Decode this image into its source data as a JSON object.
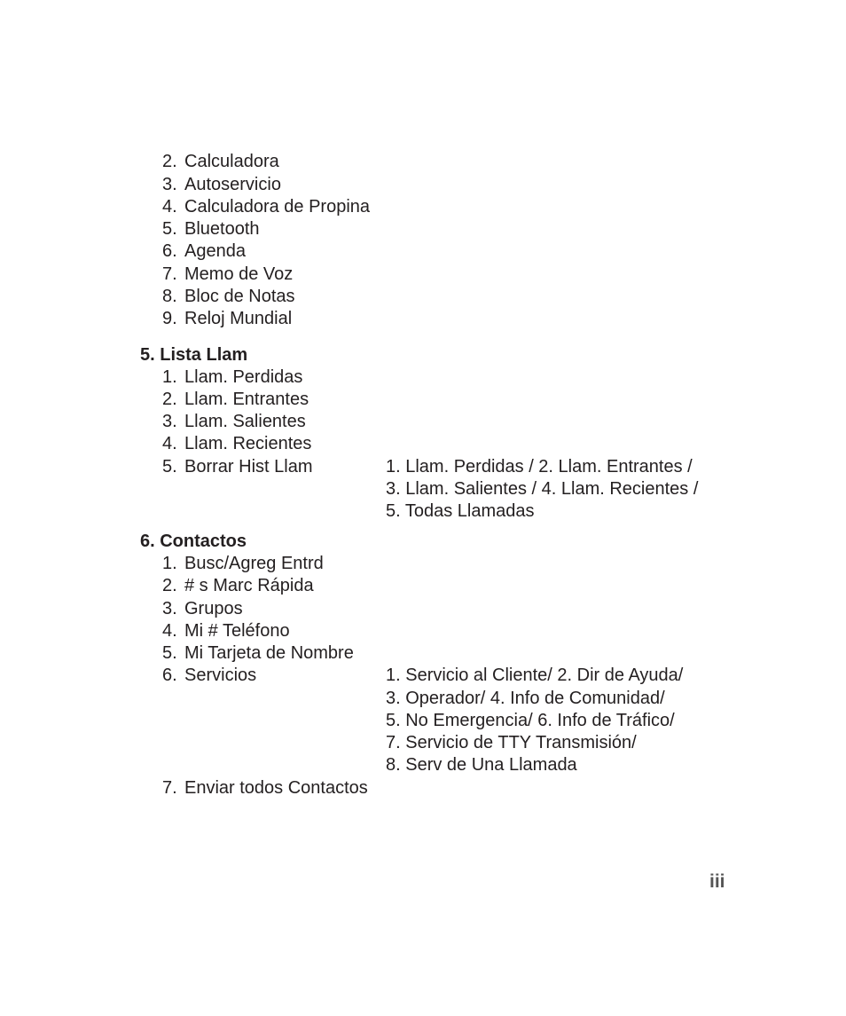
{
  "page_number": "iii",
  "tools_continued": [
    {
      "num": "2.",
      "label": "Calculadora"
    },
    {
      "num": "3.",
      "label": "Autoservicio"
    },
    {
      "num": "4.",
      "label": "Calculadora de Propina"
    },
    {
      "num": "5.",
      "label": "Bluetooth"
    },
    {
      "num": "6.",
      "label": "Agenda"
    },
    {
      "num": "7.",
      "label": "Memo de Voz"
    },
    {
      "num": "8.",
      "label": "Bloc de Notas"
    },
    {
      "num": "9.",
      "label": "Reloj Mundial"
    }
  ],
  "section5": {
    "heading": "5. Lista Llam",
    "items": [
      {
        "num": "1.",
        "label": "Llam. Perdidas"
      },
      {
        "num": "2.",
        "label": "Llam. Entrantes"
      },
      {
        "num": "3.",
        "label": "Llam. Salientes"
      },
      {
        "num": "4.",
        "label": "Llam. Recientes"
      },
      {
        "num": "5.",
        "label": "Borrar Hist Llam"
      }
    ],
    "borrar_options": [
      "1. Llam. Perdidas / 2. Llam. Entrantes /",
      "3. Llam. Salientes / 4. Llam. Recientes /",
      "5. Todas Llamadas"
    ]
  },
  "section6": {
    "heading": "6. Contactos",
    "items": [
      {
        "num": "1.",
        "label": "Busc/Agreg Entrd"
      },
      {
        "num": "2.",
        "label": "# s Marc Rápida"
      },
      {
        "num": "3.",
        "label": "Grupos"
      },
      {
        "num": "4.",
        "label": "Mi # Teléfono"
      },
      {
        "num": "5.",
        "label": "Mi Tarjeta de Nombre"
      },
      {
        "num": "6.",
        "label": "Servicios"
      },
      {
        "num": "7.",
        "label": "Enviar todos Contactos"
      }
    ],
    "servicios_options": [
      "1. Servicio al Cliente/ 2. Dir de Ayuda/",
      "3. Operador/ 4. Info de Comunidad/",
      "5. No Emergencia/ 6. Info de Tráfico/",
      "7. Servicio de TTY Transmisión/",
      "8. Serv de Una Llamada"
    ]
  }
}
